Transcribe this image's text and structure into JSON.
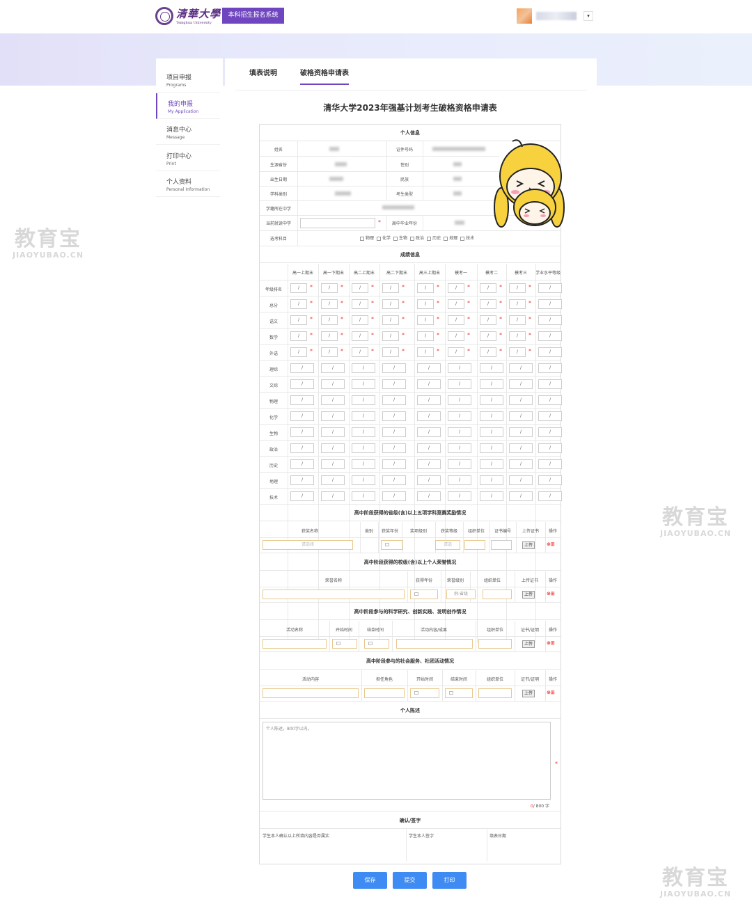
{
  "header": {
    "university_cn": "清華大學",
    "university_en": "Tsinghua University",
    "system_button": "本科招生报名系统"
  },
  "sidebar": [
    {
      "cn": "项目申报",
      "en": "Programs"
    },
    {
      "cn": "我的申报",
      "en": "My Application",
      "active": true
    },
    {
      "cn": "消息中心",
      "en": "Message"
    },
    {
      "cn": "打印中心",
      "en": "Print"
    },
    {
      "cn": "个人资料",
      "en": "Personal Information"
    }
  ],
  "tabs": [
    "填表说明",
    "破格资格申请表"
  ],
  "form_title": "清华大学2023年强基计划考生破格资格申请表",
  "personal": {
    "title": "个人信息",
    "labels": [
      "姓名",
      "证件号码",
      "生源省份",
      "性别",
      "出生日期",
      "民族",
      "学科类别",
      "考生类型",
      "学籍所在中学",
      "当前就读中学",
      "高中毕业年份",
      "选考科目"
    ],
    "subjects": [
      "物理",
      "化学",
      "生物",
      "政治",
      "历史",
      "地理",
      "技术"
    ]
  },
  "grades": {
    "title": "成绩信息",
    "columns": [
      "高一上期末",
      "高一下期末",
      "高二上期末",
      "高二下期末",
      "高三上期末",
      "模考一",
      "模考二",
      "模考三",
      "学业水平等级"
    ],
    "rows": [
      "年级排名",
      "总分",
      "语文",
      "数学",
      "外语",
      "理综",
      "文综",
      "物理",
      "化学",
      "生物",
      "政治",
      "历史",
      "地理",
      "技术"
    ],
    "cell_value": "/"
  },
  "awards": {
    "title": "高中阶段获得的省级(含)以上五项学科竞赛奖励情况",
    "cols": [
      "获奖名称",
      "类别",
      "获奖年份",
      "奖项级别",
      "获奖等级",
      "组织单位",
      "证书编号",
      "上传证书",
      "操作"
    ],
    "select_placeholder": "请选择",
    "level_placeholder": "请选"
  },
  "honors": {
    "title": "高中阶段获得的校级(含)以上个人荣誉情况",
    "cols": [
      "荣誉名称",
      "获得年份",
      "荣誉级别",
      "组织单位",
      "上传证书",
      "操作"
    ],
    "level_placeholder": "例:省级"
  },
  "research": {
    "title": "高中阶段参与的科学研究、创新实践、发明创作情况",
    "cols": [
      "活动名称",
      "开始时间",
      "结束时间",
      "活动内容/成果",
      "组织单位",
      "证书/证明",
      "操作"
    ]
  },
  "service": {
    "title": "高中阶段参与的社会服务、社团活动情况",
    "cols": [
      "活动内容",
      "担任角色",
      "开始时间",
      "结束时间",
      "组织单位",
      "证书/证明",
      "操作"
    ]
  },
  "statement": {
    "title": "个人陈述",
    "placeholder": "个人陈述，800字以内。",
    "count": "0",
    "max": "/ 800 字"
  },
  "confirm": {
    "title": "确认/签字",
    "c1": "学生本人确认以上所填内容是否属实",
    "c2": "学生本人签字",
    "c3": "填表日期"
  },
  "upload_label": "上传",
  "buttons": [
    "保存",
    "提交",
    "打印"
  ],
  "watermark": {
    "cn": "教育宝",
    "en": "JIAOYUBAO.CN"
  }
}
